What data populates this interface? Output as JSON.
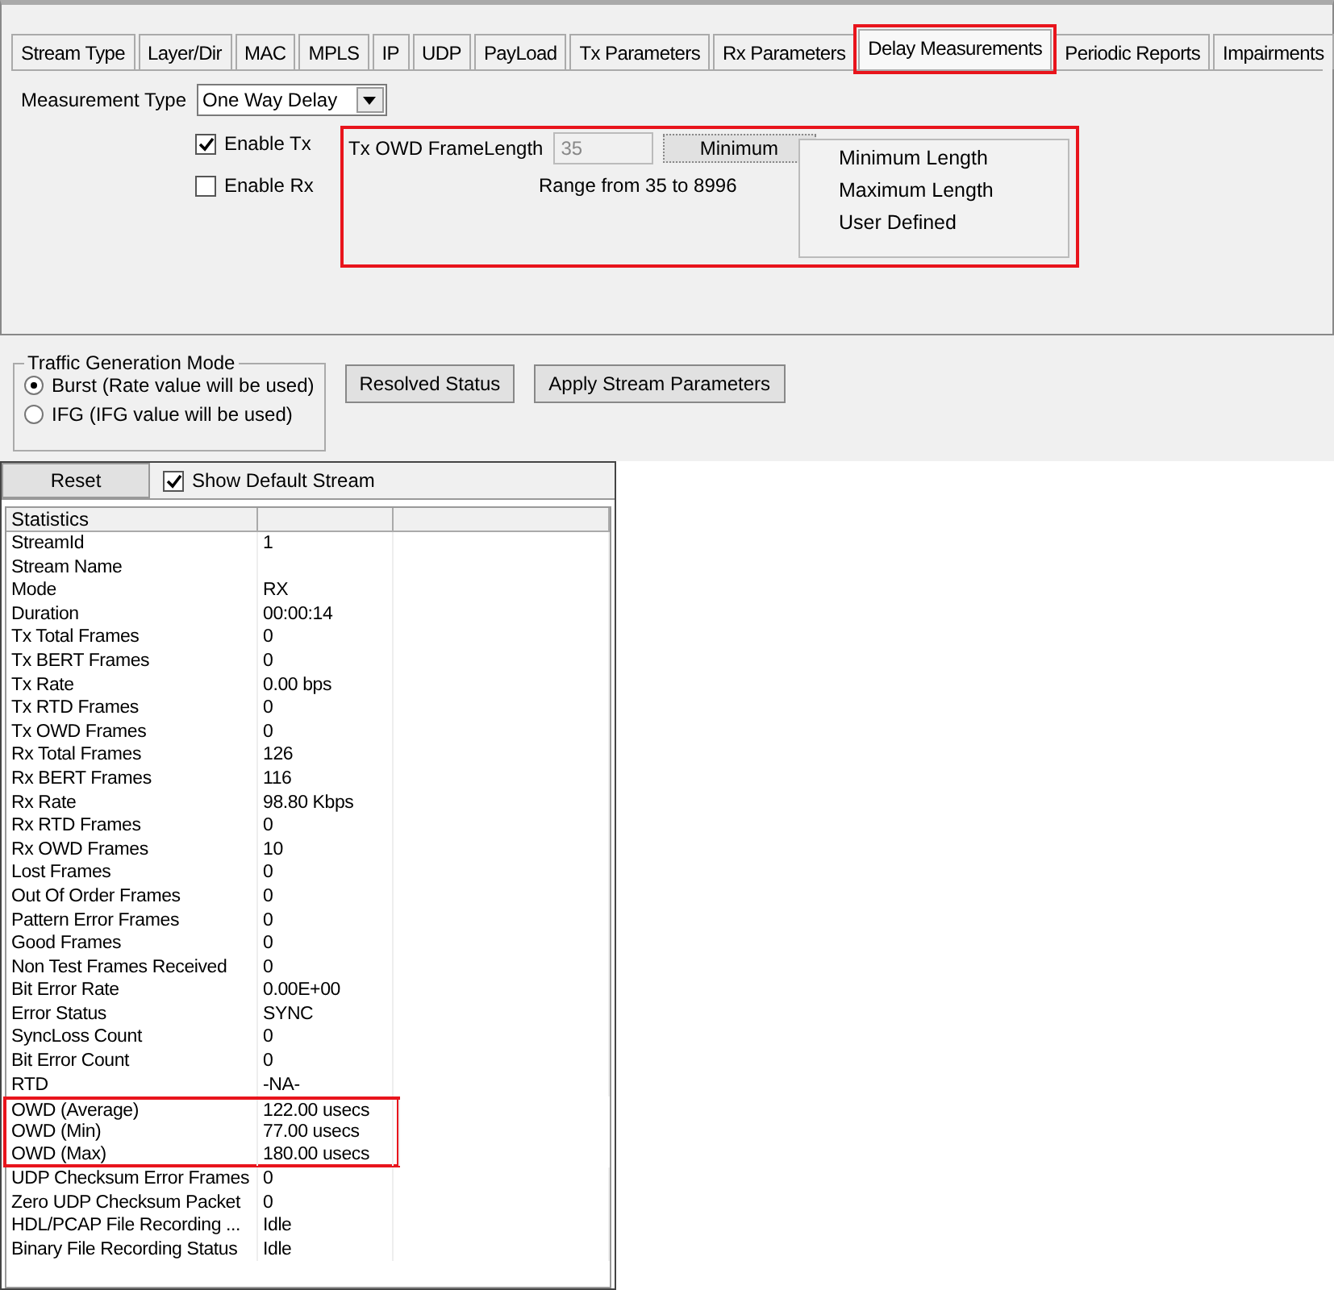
{
  "tabs": [
    {
      "label": "Stream Type",
      "selected": false,
      "highlighted": false
    },
    {
      "label": "Layer/Dir",
      "selected": false,
      "highlighted": false
    },
    {
      "label": "MAC",
      "selected": false,
      "highlighted": false
    },
    {
      "label": "MPLS",
      "selected": false,
      "highlighted": false
    },
    {
      "label": "IP",
      "selected": false,
      "highlighted": false
    },
    {
      "label": "UDP",
      "selected": false,
      "highlighted": false
    },
    {
      "label": "PayLoad",
      "selected": false,
      "highlighted": false
    },
    {
      "label": "Tx Parameters",
      "selected": false,
      "highlighted": false
    },
    {
      "label": "Rx Parameters",
      "selected": false,
      "highlighted": false
    },
    {
      "label": "Delay Measurements",
      "selected": true,
      "highlighted": true
    },
    {
      "label": "Periodic Reports",
      "selected": false,
      "highlighted": false
    },
    {
      "label": "Impairments",
      "selected": false,
      "highlighted": false
    }
  ],
  "measurement_type": {
    "label": "Measurement Type",
    "value": "One Way Delay"
  },
  "enable_options": [
    {
      "label": "Enable Tx",
      "checked": true
    },
    {
      "label": "Enable Rx",
      "checked": false
    }
  ],
  "owd_frame_length": {
    "highlighted": true,
    "label": "Tx OWD FrameLength",
    "value": "35",
    "disabled": true,
    "mode_button": "Minimum",
    "range": "Range from 35 to 8996",
    "menu": [
      "Minimum Length",
      "Maximum Length",
      "User Defined"
    ]
  },
  "traffic_generation": {
    "title": "Traffic Generation Mode",
    "options": [
      {
        "label": "Burst (Rate value will be used)",
        "selected": true
      },
      {
        "label": "IFG (IFG value will be used)",
        "selected": false
      }
    ]
  },
  "buttons": [
    "Resolved Status",
    "Apply Stream Parameters"
  ],
  "stats_toolbar": {
    "reset": "Reset",
    "show_default": {
      "label": "Show Default Stream",
      "checked": true
    }
  },
  "table": {
    "columns": [
      "Statistics"
    ],
    "rows": [
      {
        "name": "StreamId",
        "value": "1",
        "highlighted": false
      },
      {
        "name": "Stream Name",
        "value": "",
        "highlighted": false
      },
      {
        "name": "Mode",
        "value": "RX",
        "highlighted": false
      },
      {
        "name": "Duration",
        "value": "00:00:14",
        "highlighted": false
      },
      {
        "name": "Tx Total Frames",
        "value": "0",
        "highlighted": false
      },
      {
        "name": "Tx BERT Frames",
        "value": "0",
        "highlighted": false
      },
      {
        "name": "Tx Rate",
        "value": "0.00 bps",
        "highlighted": false
      },
      {
        "name": "Tx RTD Frames",
        "value": "0",
        "highlighted": false
      },
      {
        "name": "Tx OWD Frames",
        "value": "0",
        "highlighted": false
      },
      {
        "name": "Rx Total Frames",
        "value": "126",
        "highlighted": false
      },
      {
        "name": "Rx BERT Frames",
        "value": "116",
        "highlighted": false
      },
      {
        "name": "Rx Rate",
        "value": "98.80 Kbps",
        "highlighted": false
      },
      {
        "name": "Rx RTD Frames",
        "value": "0",
        "highlighted": false
      },
      {
        "name": "Rx OWD Frames",
        "value": "10",
        "highlighted": false
      },
      {
        "name": "Lost Frames",
        "value": "0",
        "highlighted": false
      },
      {
        "name": "Out Of Order Frames",
        "value": "0",
        "highlighted": false
      },
      {
        "name": "Pattern Error Frames",
        "value": "0",
        "highlighted": false
      },
      {
        "name": "Good Frames",
        "value": "0",
        "highlighted": false
      },
      {
        "name": "Non Test Frames Received",
        "value": "0",
        "highlighted": false
      },
      {
        "name": "Bit Error Rate",
        "value": "0.00E+00",
        "highlighted": false
      },
      {
        "name": "Error Status",
        "value": "SYNC",
        "highlighted": false
      },
      {
        "name": "SyncLoss Count",
        "value": "0",
        "highlighted": false
      },
      {
        "name": "Bit Error Count",
        "value": "0",
        "highlighted": false
      },
      {
        "name": "RTD",
        "value": "-NA-",
        "highlighted": false
      },
      {
        "name": "OWD (Average)",
        "value": "122.00 usecs",
        "highlighted": true
      },
      {
        "name": "OWD (Min)",
        "value": "77.00 usecs",
        "highlighted": true
      },
      {
        "name": "OWD (Max)",
        "value": "180.00 usecs",
        "highlighted": true
      },
      {
        "name": "UDP Checksum Error Frames",
        "value": "0",
        "highlighted": false
      },
      {
        "name": "Zero UDP Checksum Packet",
        "value": "0",
        "highlighted": false
      },
      {
        "name": "HDL/PCAP File Recording ...",
        "value": "Idle",
        "highlighted": false
      },
      {
        "name": "Binary File Recording Status",
        "value": "Idle",
        "highlighted": false
      }
    ]
  }
}
